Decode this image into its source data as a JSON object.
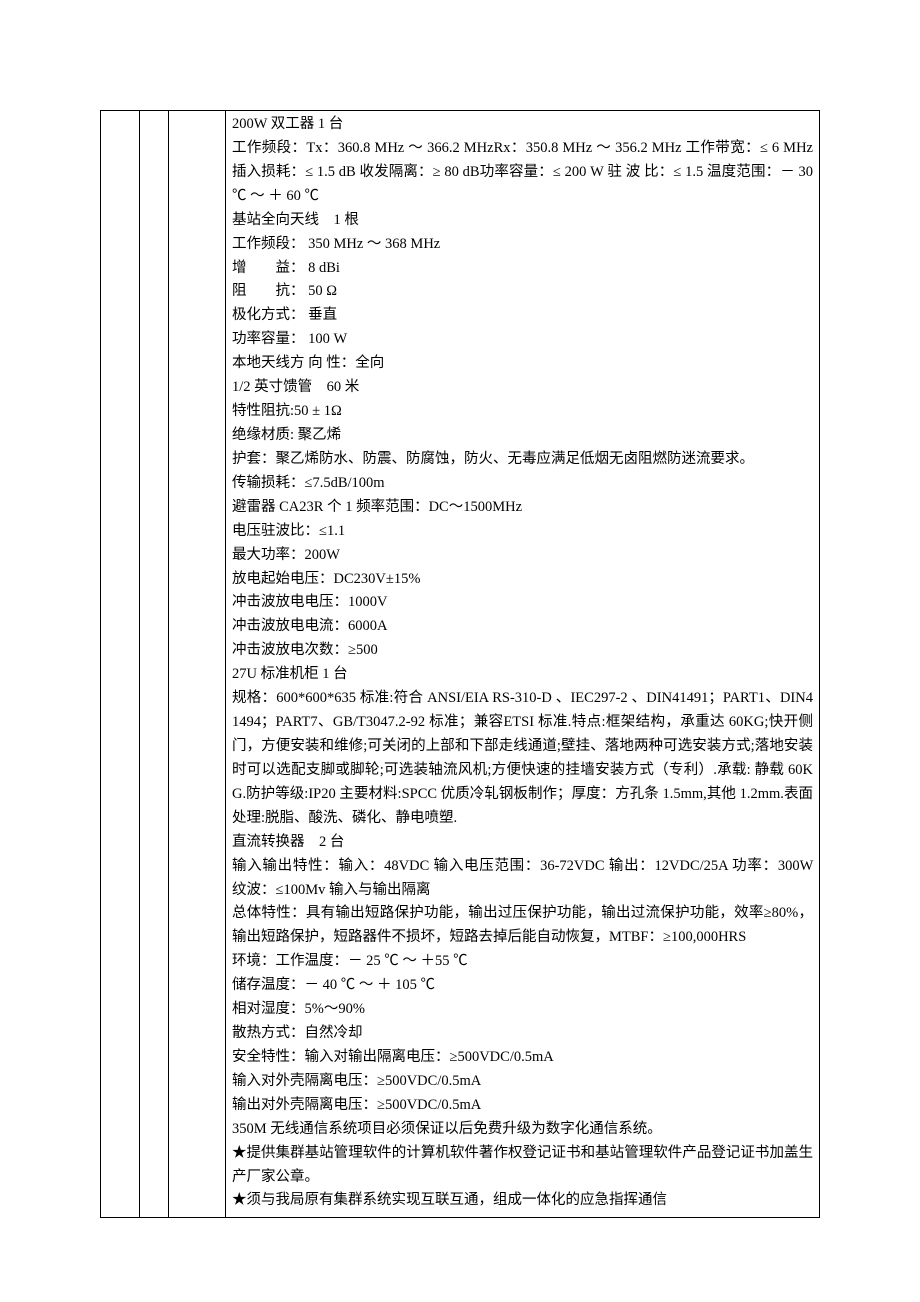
{
  "lines": [
    "200W 双工器 1 台",
    "工作频段：Tx：360.8 MHz ～ 366.2 MHzRx：350.8 MHz ～ 356.2 MHz 工作带宽：≤ 6 MHz 插入损耗：≤ 1.5 dB 收发隔离：≥ 80 dB功率容量：≤ 200 W 驻 波 比：≤ 1.5 温度范围：－ 30 ℃ ～ ＋ 60 ℃",
    "基站全向天线　1 根",
    "工作频段： 350 MHz ～ 368 MHz",
    "增　　益： 8 dBi",
    "阻　　抗： 50 Ω",
    "极化方式： 垂直",
    "功率容量： 100 W",
    "本地天线方 向 性：全向",
    "1/2 英寸馈管　60 米",
    "特性阻抗:50 ± 1Ω",
    "绝缘材质: 聚乙烯",
    "护套：聚乙烯防水、防震、防腐蚀，防火、无毒应满足低烟无卤阻燃防迷流要求。",
    "传输损耗：≤7.5dB/100m",
    "避雷器 CA23R 个 1 频率范围：DC～1500MHz",
    "电压驻波比：≤1.1",
    "最大功率：200W",
    "放电起始电压：DC230V±15%",
    "冲击波放电电压：1000V",
    "冲击波放电电流：6000A",
    "冲击波放电次数：≥500",
    "27U 标准机柜 1 台",
    "规格：600*600*635 标准:符合 ANSI/EIA RS-310-D 、IEC297-2 、DIN41491；PART1、DIN41494；PART7、GB/T3047.2-92 标准；兼容ETSI 标准.特点:框架结构，承重达 60KG;快开侧门，方便安装和维修;可关闭的上部和下部走线通道;壁挂、落地两种可选安装方式;落地安装时可以选配支脚或脚轮;可选装轴流风机;方便快速的挂墙安装方式（专利）.承载: 静载 60KG.防护等级:IP20 主要材料:SPCC 优质冷轧钢板制作；厚度：方孔条 1.5mm,其他 1.2mm.表面处理:脱脂、酸洗、磷化、静电喷塑.",
    "直流转换器　2 台",
    "输入输出特性：输入：48VDC 输入电压范围：36-72VDC 输出：12VDC/25A 功率：300W　　　纹波：≤100Mv 输入与输出隔离",
    "总体特性：具有输出短路保护功能，输出过压保护功能，输出过流保护功能，效率≥80%，输出短路保护，短路器件不损坏，短路去掉后能自动恢复，MTBF：≥100,000HRS",
    "环境：工作温度：－ 25 ℃ ～ ＋55 ℃",
    "储存温度：－ 40 ℃ ～ ＋ 105 ℃",
    "相对湿度：5%～90%",
    "散热方式：自然冷却",
    "安全特性：输入对输出隔离电压：≥500VDC/0.5mA",
    "输入对外壳隔离电压：≥500VDC/0.5mA",
    "输出对外壳隔离电压：≥500VDC/0.5mA",
    "350M 无线通信系统项目必须保证以后免费升级为数字化通信系统。",
    "★提供集群基站管理软件的计算机软件著作权登记证书和基站管理软件产品登记证书加盖生产厂家公章。",
    "★须与我局原有集群系统实现互联互通，组成一体化的应急指挥通信"
  ]
}
